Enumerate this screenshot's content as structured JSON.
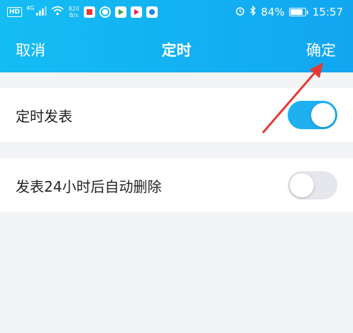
{
  "status_bar": {
    "hd": "HD",
    "net_gen": "4G",
    "net_speed_value": "820",
    "net_speed_unit": "B/s",
    "battery": "84%",
    "time": "15:57"
  },
  "nav": {
    "cancel": "取消",
    "title": "定时",
    "confirm": "确定"
  },
  "settings": [
    {
      "label": "定时发表",
      "enabled": true
    },
    {
      "label": "发表24小时后自动删除",
      "enabled": false
    }
  ],
  "colors": {
    "header_start": "#14bdf3",
    "header_end": "#12a6f1",
    "toggle_on": "#1fb0f0",
    "toggle_off": "#e6e7ec",
    "annotation_arrow": "#e53935"
  },
  "icons": [
    "signal-icon",
    "wifi-icon",
    "alarm-icon",
    "bluetooth-icon",
    "battery-icon"
  ]
}
